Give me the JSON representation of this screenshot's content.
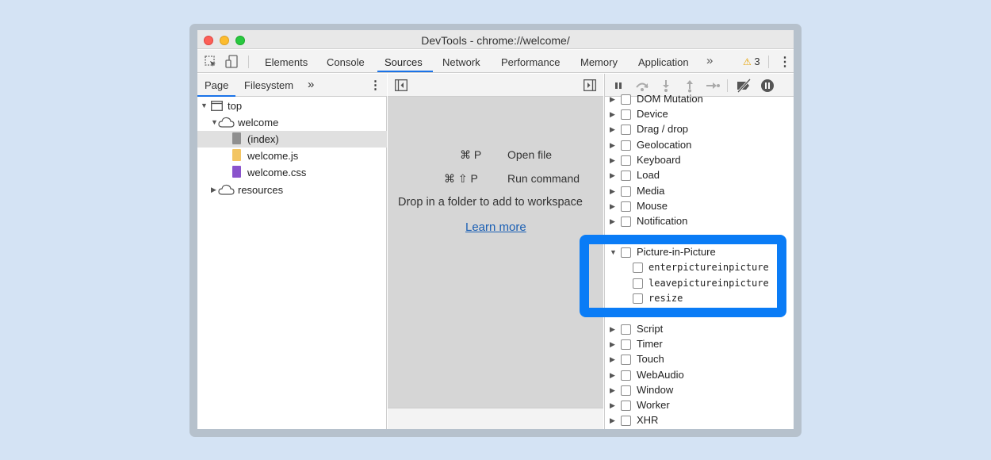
{
  "window": {
    "title": "DevTools - chrome://welcome/"
  },
  "toolbar": {
    "tabs": [
      "Elements",
      "Console",
      "Sources",
      "Network",
      "Performance",
      "Memory",
      "Application"
    ],
    "active_tab": "Sources",
    "more": "»",
    "warning_count": "3",
    "warning_icon": "⚠"
  },
  "navigator": {
    "tabs": [
      "Page",
      "Filesystem"
    ],
    "more": "»",
    "tree": {
      "top": "top",
      "welcome": "welcome",
      "index": "(index)",
      "welcome_js": "welcome.js",
      "welcome_css": "welcome.css",
      "resources": "resources"
    }
  },
  "editor": {
    "shortcut1_keys": "⌘ P",
    "shortcut1_label": "Open file",
    "shortcut2_keys": "⌘ ⇧ P",
    "shortcut2_label": "Run command",
    "drop_text": "Drop in a folder to add to workspace",
    "learn_more": "Learn more"
  },
  "breakpoints": {
    "items": [
      "DOM Mutation",
      "Device",
      "Drag / drop",
      "Geolocation",
      "Keyboard",
      "Load",
      "Media",
      "Mouse",
      "Notification"
    ],
    "pip": "Picture-in-Picture",
    "pip_events": [
      "enterpictureinpicture",
      "leavepictureinpicture",
      "resize"
    ],
    "items_after": [
      "Script",
      "Timer",
      "Touch",
      "WebAudio",
      "Window",
      "Worker",
      "XHR"
    ]
  },
  "colors": {
    "accent": "#1a73e8",
    "highlight": "#0a7cf6"
  }
}
